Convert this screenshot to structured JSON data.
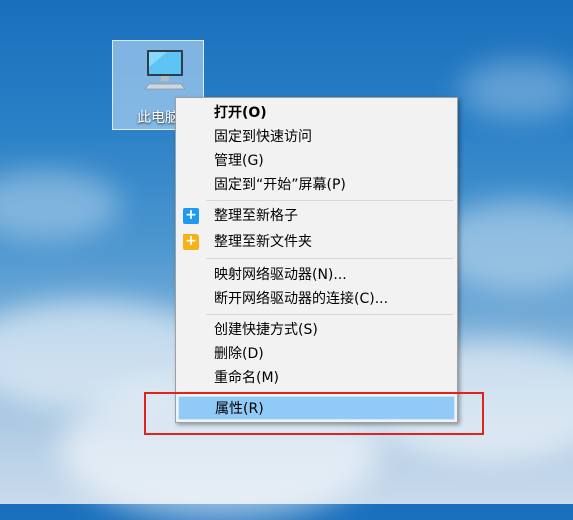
{
  "desktop": {
    "icon_label": "此电脑"
  },
  "context_menu": {
    "items": [
      {
        "label": "打开(O)",
        "bold": true
      },
      {
        "label": "固定到快速访问"
      },
      {
        "label": "管理(G)"
      },
      {
        "label": "固定到“开始”屏幕(P)"
      },
      {
        "label": "整理至新格子",
        "icon": "plus-icon"
      },
      {
        "label": "整理至新文件夹",
        "icon": "folder-plus-icon"
      },
      {
        "label": "映射网络驱动器(N)..."
      },
      {
        "label": "断开网络驱动器的连接(C)..."
      },
      {
        "label": "创建快捷方式(S)"
      },
      {
        "label": "删除(D)"
      },
      {
        "label": "重命名(M)"
      },
      {
        "label": "属性(R)",
        "highlighted": true
      }
    ]
  },
  "colors": {
    "menu_background": "#f2f2f2",
    "hover_background": "#91c9f7",
    "annotation_box": "#e2231a"
  }
}
